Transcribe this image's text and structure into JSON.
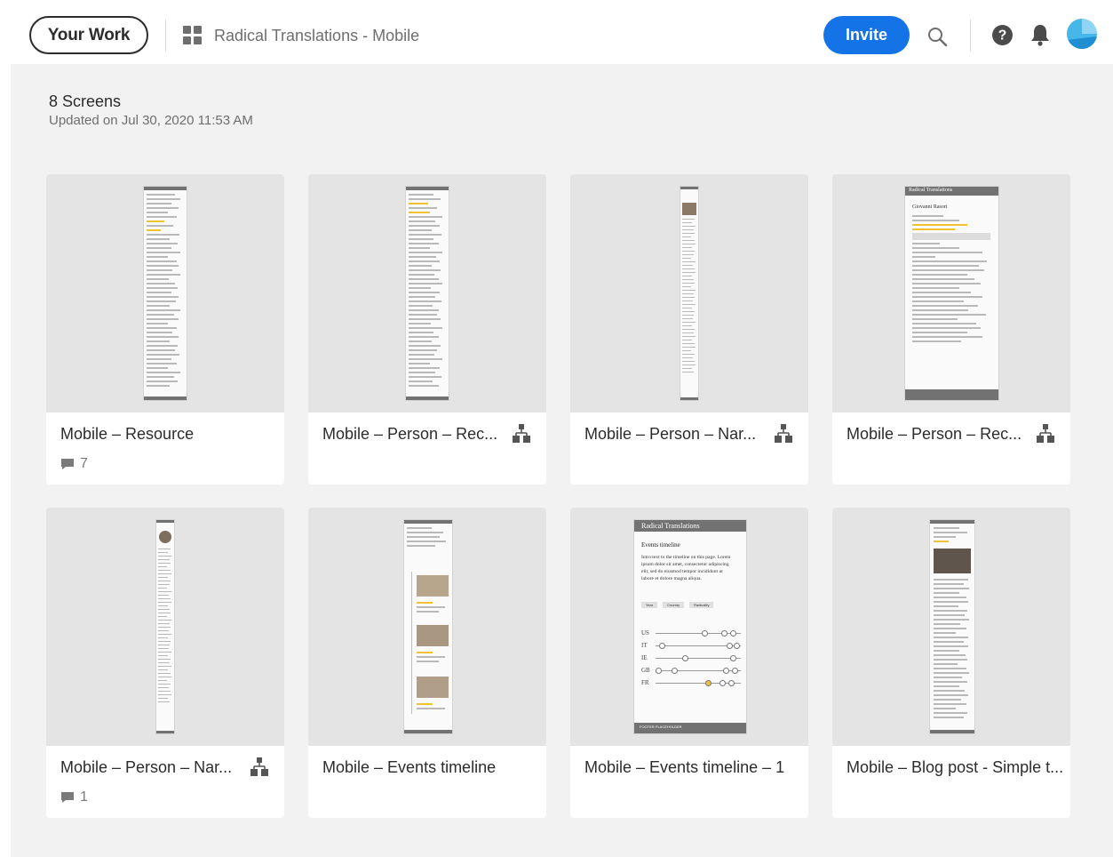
{
  "header": {
    "your_work_label": "Your Work",
    "project_title": "Radical Translations - Mobile",
    "invite_label": "Invite",
    "icons": [
      "grid-icon",
      "search-icon",
      "help-icon",
      "bell-icon",
      "avatar"
    ],
    "colors": {
      "invite": "#1473e6",
      "avatar": "#45b7e8"
    }
  },
  "summary": {
    "screens_count": "8 Screens",
    "updated": "Updated on Jul 30, 2020 11:53 AM"
  },
  "cards": [
    {
      "name": "Mobile – Resource",
      "comments": "7"
    },
    {
      "name": "Mobile – Person – Rec..."
    },
    {
      "name": "Mobile – Person – Nar..."
    },
    {
      "name": "Mobile – Person – Rec..."
    },
    {
      "name": "Mobile – Person – Nar...",
      "comments": "1"
    },
    {
      "name": "Mobile – Events timeline"
    },
    {
      "name": "Mobile – Events timeline – 1"
    },
    {
      "name": "Mobile – Blog post - Simple t..."
    }
  ],
  "thumb_text": {
    "site_title": "Radical Translations",
    "person_name": "Giovanni Rasori",
    "events_heading": "Events timeline",
    "events_intro": "Intro text to the timeline on this page. Lorem ipsum dolor sit amet, consectetur adipiscing elit, sed do eiusmod tempor incididunt ut labore et dolore magna aliqua.",
    "countries": [
      "US",
      "IT",
      "IE",
      "GB",
      "FR"
    ],
    "filters": [
      "Year",
      "Country",
      "Radicality"
    ],
    "footer": "FOOTER PLACEHOLDER"
  }
}
